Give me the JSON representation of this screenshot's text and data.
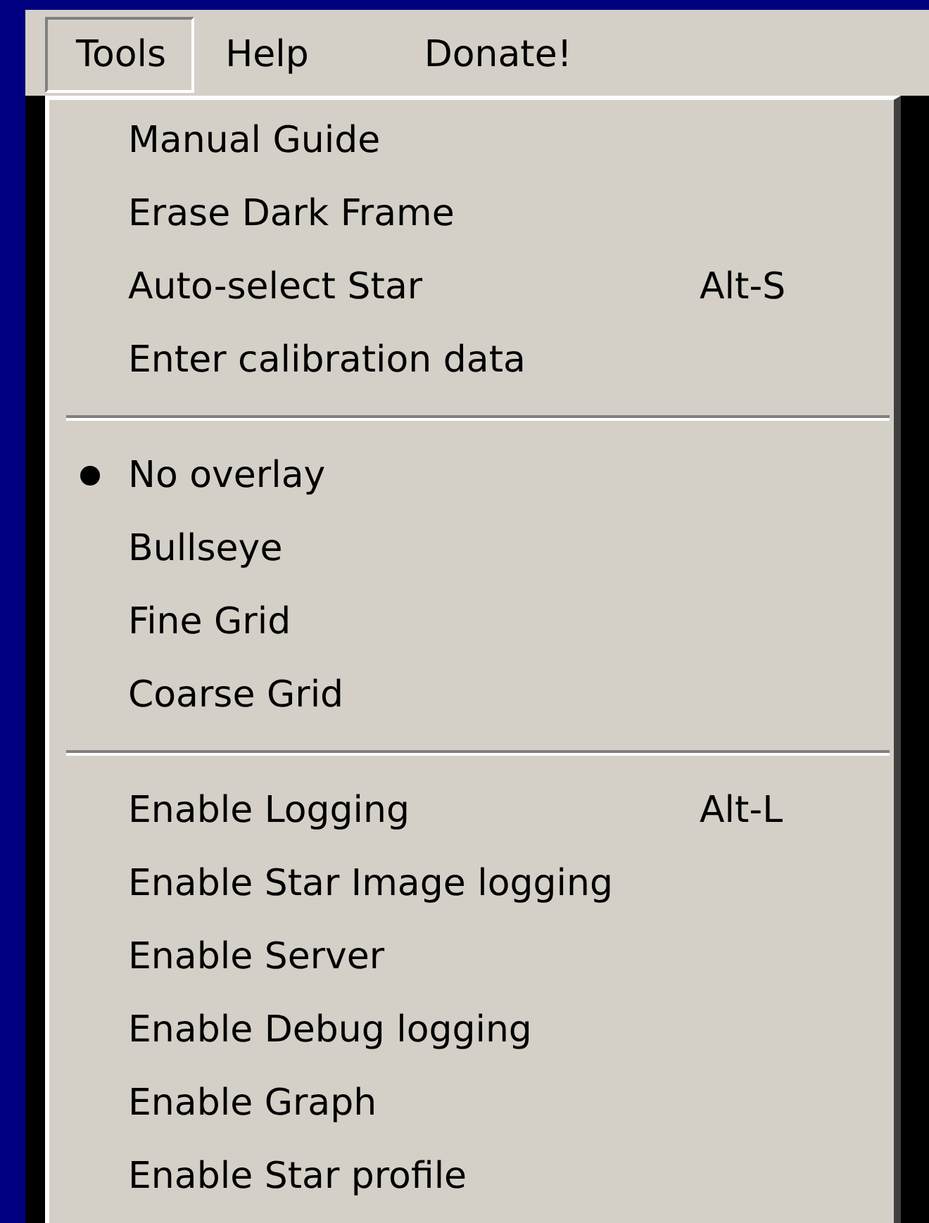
{
  "menu_bar": [
    {
      "label": "Tools",
      "selected": true
    },
    {
      "label": "Help",
      "selected": false
    },
    {
      "label": "Donate!",
      "selected": false
    }
  ],
  "menu": {
    "sections": [
      {
        "items": [
          {
            "kind": "command",
            "label": "Manual Guide"
          },
          {
            "kind": "command",
            "label": "Erase Dark Frame"
          },
          {
            "kind": "command",
            "label": "Auto-select Star",
            "shortcut": "Alt-S"
          },
          {
            "kind": "command",
            "label": "Enter calibration data"
          }
        ]
      },
      {
        "items": [
          {
            "kind": "radio",
            "label": "No overlay",
            "checked": true
          },
          {
            "kind": "radio",
            "label": "Bullseye",
            "checked": false
          },
          {
            "kind": "radio",
            "label": "Fine Grid",
            "checked": false
          },
          {
            "kind": "radio",
            "label": "Coarse Grid",
            "checked": false
          }
        ]
      },
      {
        "items": [
          {
            "kind": "command",
            "label": "Enable Logging",
            "shortcut": "Alt-L"
          },
          {
            "kind": "command",
            "label": "Enable Star Image logging"
          },
          {
            "kind": "command",
            "label": "Enable Server"
          },
          {
            "kind": "command",
            "label": "Enable Debug logging"
          },
          {
            "kind": "command",
            "label": "Enable Graph"
          },
          {
            "kind": "command",
            "label": "Enable Star profile"
          }
        ]
      }
    ]
  }
}
